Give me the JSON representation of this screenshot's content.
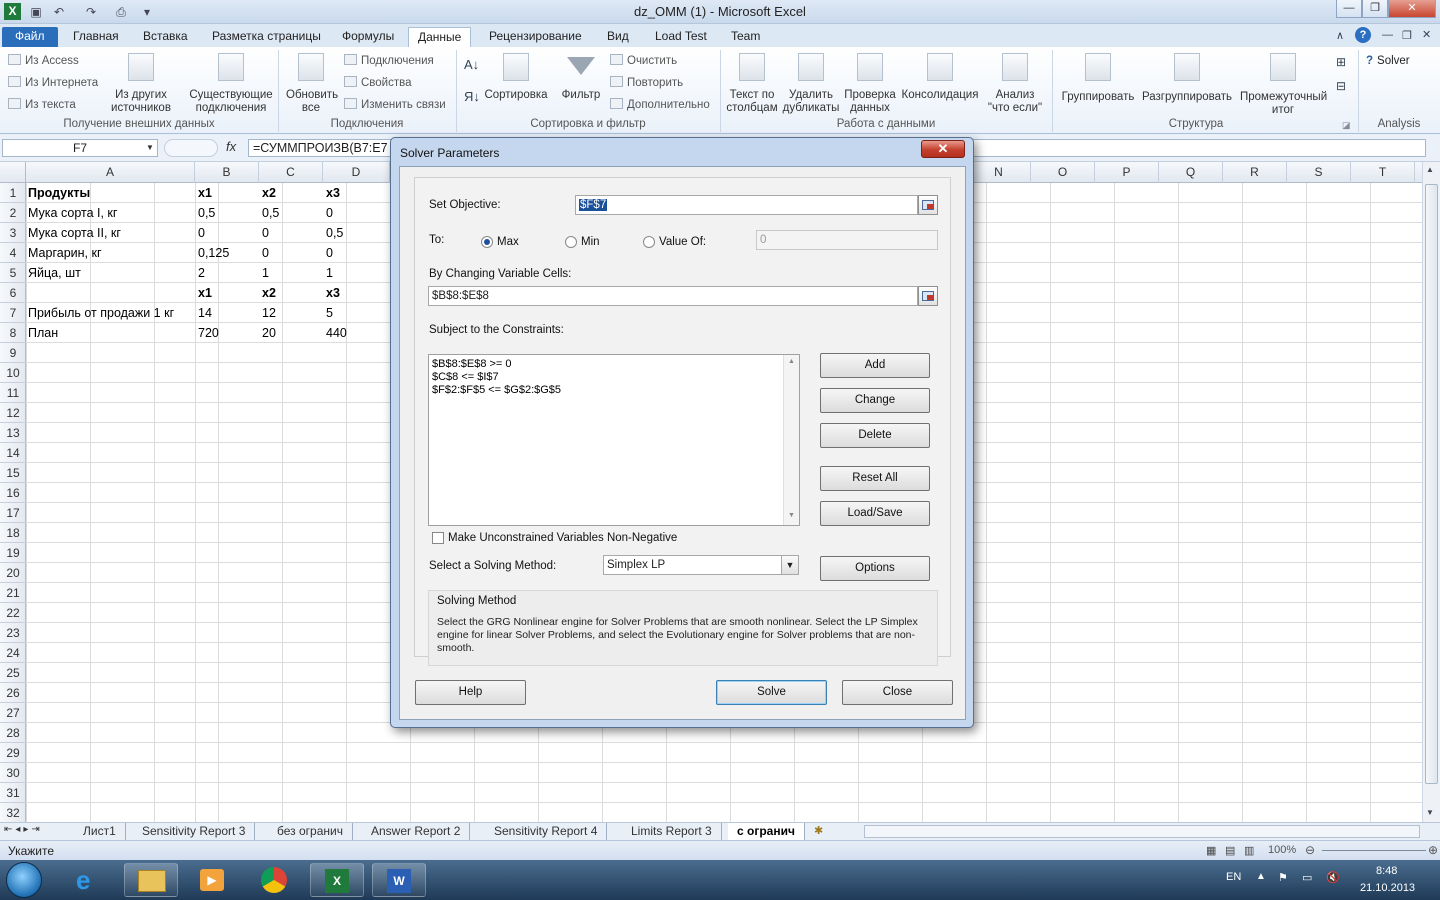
{
  "window": {
    "title": "dz_OMM (1)  -  Microsoft Excel"
  },
  "ribbon_tabs": [
    "Файл",
    "Главная",
    "Вставка",
    "Разметка страницы",
    "Формулы",
    "Данные",
    "Рецензирование",
    "Вид",
    "Load Test",
    "Team"
  ],
  "ribbon": {
    "external": {
      "from_access": "Из Access",
      "from_web": "Из Интернета",
      "from_text": "Из текста",
      "other_sources": "Из других источников",
      "existing_connections": "Существующие подключения",
      "label": "Получение внешних данных"
    },
    "connections": {
      "refresh_all": "Обновить все",
      "connections": "Подключения",
      "properties": "Свойства",
      "edit_links": "Изменить связи",
      "label": "Подключения"
    },
    "sortfilter": {
      "sort": "Сортировка",
      "filter": "Фильтр",
      "clear": "Очистить",
      "reapply": "Повторить",
      "advanced": "Дополнительно",
      "label": "Сортировка и фильтр"
    },
    "datatools": {
      "text_to_columns": "Текст по столбцам",
      "remove_duplicates": "Удалить дубликаты",
      "data_validation": "Проверка данных",
      "consolidate": "Консолидация",
      "whatif": "Анализ \"что если\"",
      "label": "Работа с данными"
    },
    "outline": {
      "group": "Группировать",
      "ungroup": "Разгруппировать",
      "subtotal": "Промежуточный итог",
      "label": "Структура"
    },
    "analysis": {
      "solver": "Solver",
      "label": "Analysis"
    }
  },
  "formula_bar": {
    "name_box": "F7",
    "fx": "fx",
    "formula": "=СУММПРОИЗВ(B7:E7"
  },
  "grid": {
    "columns": [
      "A",
      "B",
      "C",
      "D",
      "N",
      "O",
      "P",
      "Q",
      "R",
      "S",
      "T"
    ],
    "rows": [
      "1",
      "2",
      "3",
      "4",
      "5",
      "6",
      "7",
      "8",
      "9",
      "10",
      "11",
      "12",
      "13",
      "14",
      "15",
      "16",
      "17",
      "18",
      "19",
      "20",
      "21",
      "22",
      "23",
      "24",
      "25",
      "26",
      "27",
      "28",
      "29",
      "30",
      "31",
      "32"
    ],
    "cells": [
      [
        "Продукты",
        "x1",
        "x2",
        "x3"
      ],
      [
        "Мука сорта I, кг",
        "0,5",
        "0,5",
        "0"
      ],
      [
        "Мука сорта II, кг",
        "0",
        "0",
        "0,5"
      ],
      [
        "Маргарин, кг",
        "0,125",
        "0",
        "0"
      ],
      [
        "Яйца, шт",
        "2",
        "1",
        "1"
      ],
      [
        "",
        "x1",
        "x2",
        "x3"
      ],
      [
        "Прибыль от продажи 1 кг",
        "14",
        "12",
        "5"
      ],
      [
        "План",
        "720",
        "20",
        "440"
      ]
    ]
  },
  "sheet_tabs": [
    "Лист1",
    "Sensitivity Report 3",
    "без огранич",
    "Answer Report 2",
    "Sensitivity Report 4",
    "Limits Report 3",
    "с огранич"
  ],
  "status": {
    "mode": "Укажите",
    "zoom": "100%"
  },
  "taskbar": {
    "lang": "EN",
    "time": "8:48",
    "date": "21.10.2013"
  },
  "solver": {
    "title": "Solver Parameters",
    "set_objective_label": "Set Objective:",
    "objective_value": "$F$7",
    "to_label": "To:",
    "max": "Max",
    "min": "Min",
    "value_of": "Value Of:",
    "value_of_value": "0",
    "changing_label": "By Changing Variable Cells:",
    "changing_value": "$B$8:$E$8",
    "constraints_label": "Subject to the Constraints:",
    "constraints": [
      "$B$8:$E$8 >= 0",
      "$C$8 <= $I$7",
      "$F$2:$F$5 <= $G$2:$G$5"
    ],
    "buttons": {
      "add": "Add",
      "change": "Change",
      "delete": "Delete",
      "reset_all": "Reset All",
      "load_save": "Load/Save",
      "options": "Options",
      "help": "Help",
      "solve": "Solve",
      "close": "Close"
    },
    "nonneg_label": "Make Unconstrained Variables Non-Negative",
    "method_label": "Select a Solving Method:",
    "method_value": "Simplex LP",
    "solving_method_title": "Solving Method",
    "solving_method_text": "Select the GRG Nonlinear engine for Solver Problems that are smooth nonlinear. Select the LP Simplex engine for linear Solver Problems, and select the Evolutionary engine for Solver problems that are non-smooth."
  }
}
